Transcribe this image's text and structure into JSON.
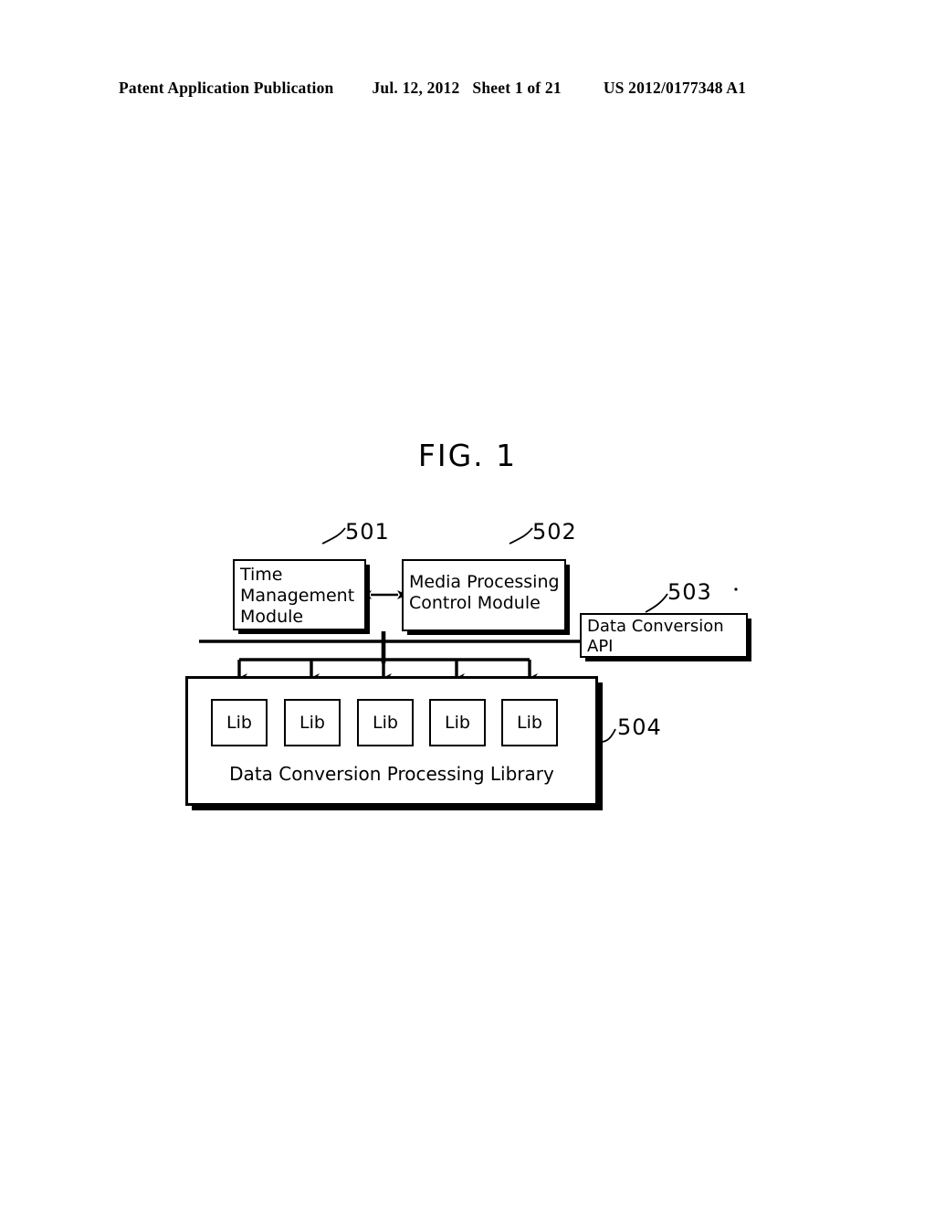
{
  "header": {
    "publication": "Patent Application Publication",
    "date": "Jul. 12, 2012",
    "sheet": "Sheet 1 of 21",
    "doc_number": "US 2012/0177348 A1"
  },
  "figure": {
    "title": "FIG. 1",
    "boxes": {
      "time_management": {
        "label": "Time\nManagement\nModule",
        "ref": "501"
      },
      "media_control": {
        "label": "Media Processing\nControl Module",
        "ref": "502"
      },
      "data_conversion_api": {
        "label": "Data Conversion\nAPI",
        "ref": "503"
      },
      "library": {
        "caption": "Data Conversion Processing Library",
        "ref": "504"
      }
    },
    "lib_blocks": [
      {
        "label": "Lib"
      },
      {
        "label": "Lib"
      },
      {
        "label": "Lib"
      },
      {
        "label": "Lib"
      },
      {
        "label": "Lib"
      }
    ]
  }
}
